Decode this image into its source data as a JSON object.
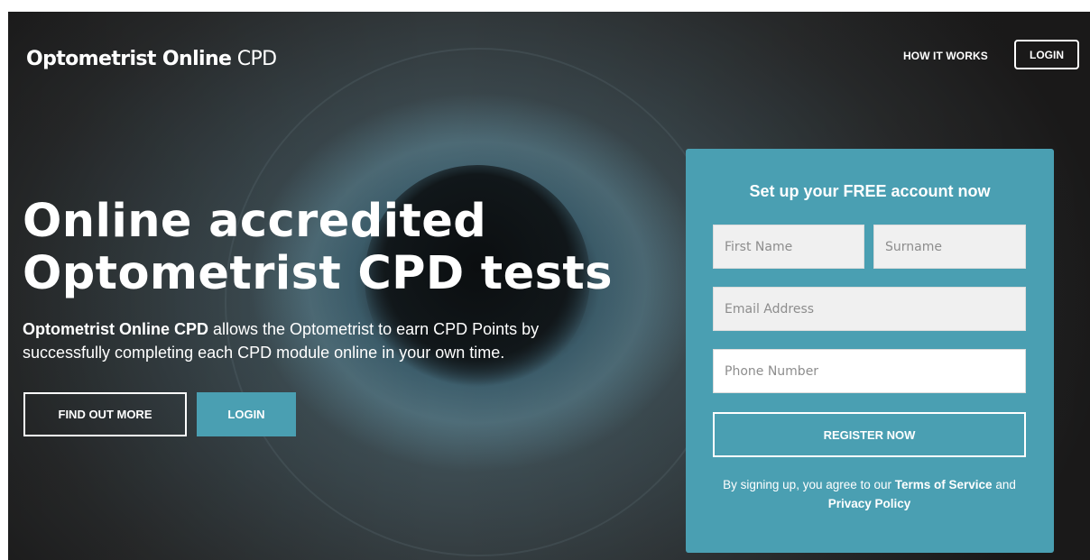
{
  "brand": {
    "bold": "Optometrist Online",
    "light": "CPD"
  },
  "nav": {
    "how_it_works": "HOW IT WORKS",
    "login": "LOGIN"
  },
  "hero": {
    "headline_line1": "Online accredited",
    "headline_line2": "Optometrist CPD tests",
    "subtext_bold": "Optometrist Online CPD",
    "subtext_rest": " allows the Optometrist to earn CPD Points by successfully completing each CPD module online in your own time.",
    "find_out_more": "FIND OUT MORE",
    "login": "LOGIN"
  },
  "signup": {
    "title": "Set up your FREE account now",
    "first_name_placeholder": "First Name",
    "surname_placeholder": "Surname",
    "email_placeholder": "Email Address",
    "phone_placeholder": "Phone Number",
    "register": "REGISTER NOW",
    "terms_prefix": "By signing up, you agree to our ",
    "terms_link": "Terms of Service",
    "terms_and": " and ",
    "privacy_link": "Privacy Policy"
  },
  "colors": {
    "accent": "#4a9fb2",
    "text": "#ffffff"
  }
}
